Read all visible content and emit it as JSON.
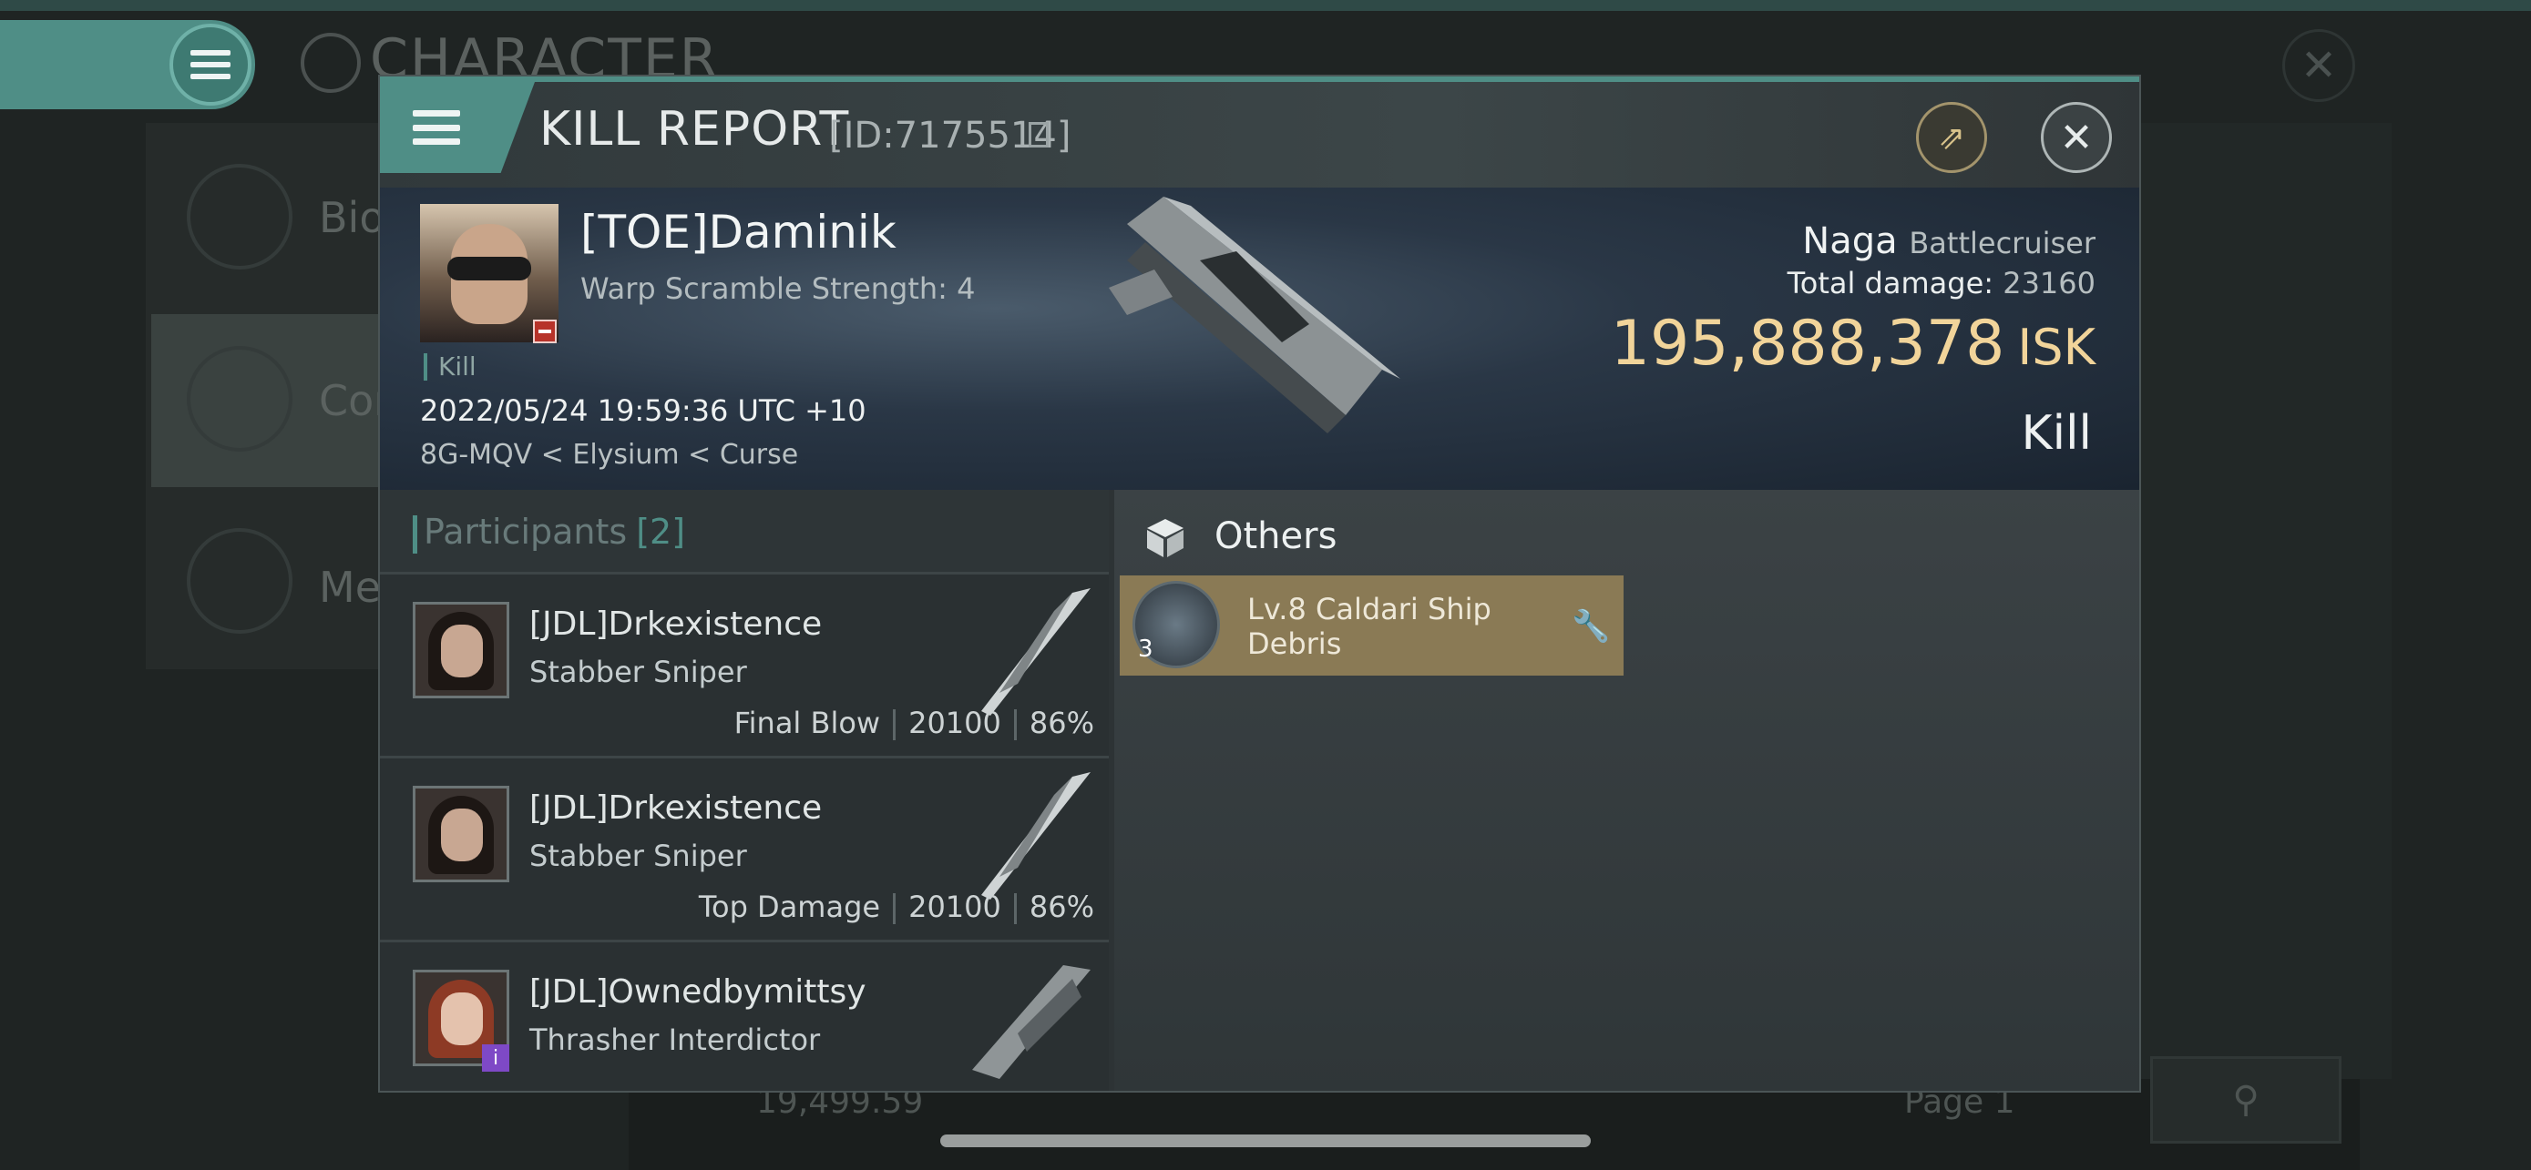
{
  "background": {
    "page_title": "CHARACTER",
    "side_items": [
      "Bio",
      "Cor",
      "Me"
    ],
    "balance": "19,499.59",
    "page_label": "Page 1"
  },
  "modal": {
    "title": "KILL REPORT",
    "id": "[ID:7175514]",
    "victim": {
      "name": "[TOE]Daminik",
      "warp_scramble": "Warp Scramble Strength: 4",
      "kill_tag": "Kill",
      "datetime": "2022/05/24 19:59:36 UTC +10",
      "location": "8G-MQV < Elysium < Curse"
    },
    "ship": {
      "name": "Naga",
      "class": "Battlecruiser",
      "total_damage_label": "Total damage:",
      "total_damage": "23160",
      "isk_value": "195,888,378",
      "isk_unit": "ISK",
      "result": "Kill"
    },
    "participants": {
      "label": "Participants",
      "count": "[2]",
      "rows": [
        {
          "name": "[JDL]Drkexistence",
          "ship": "Stabber Sniper",
          "tag": "Final Blow",
          "damage": "20100",
          "percent": "86%"
        },
        {
          "name": "[JDL]Drkexistence",
          "ship": "Stabber Sniper",
          "tag": "Top Damage",
          "damage": "20100",
          "percent": "86%"
        },
        {
          "name": "[JDL]Ownedbymittsy",
          "ship": "Thrasher Interdictor",
          "tag": "",
          "damage": "",
          "percent": ""
        }
      ]
    },
    "others": {
      "label": "Others",
      "item": {
        "name": "Lv.8 Caldari Ship Debris",
        "qty": "3"
      }
    }
  },
  "colors": {
    "accent": "#4f8e86",
    "isk": "#f1d49a",
    "item_card": "#8a7a55"
  }
}
